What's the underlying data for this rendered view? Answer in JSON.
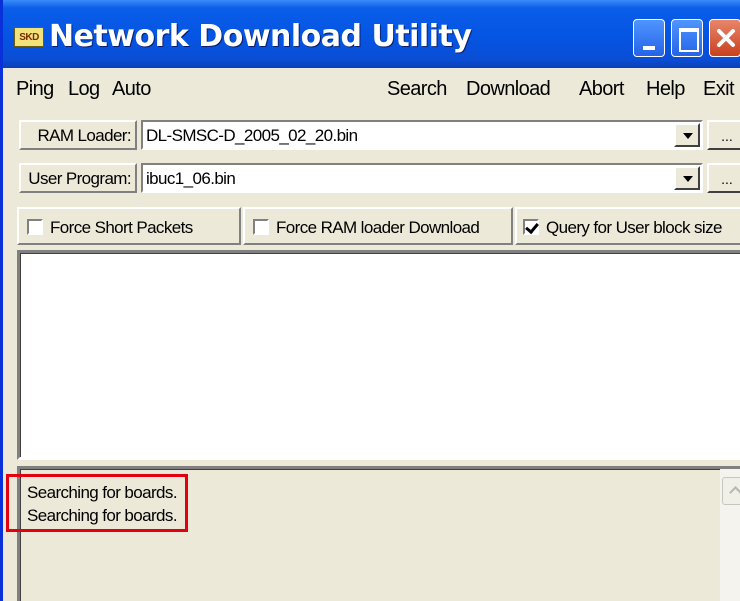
{
  "window": {
    "title": "Network Download Utility",
    "icon_text": "SKD"
  },
  "menu": {
    "ping": "Ping",
    "log": "Log",
    "auto": "Auto",
    "search": "Search",
    "download": "Download",
    "abort": "Abort",
    "help": "Help",
    "exit": "Exit"
  },
  "ram_loader": {
    "label": "RAM Loader:",
    "value": "DL-SMSC-D_2005_02_20.bin",
    "browse": "..."
  },
  "user_program": {
    "label": "User Program:",
    "value": "ibuc1_06.bin",
    "browse": "..."
  },
  "options": {
    "force_short_packets": {
      "label": "Force Short Packets",
      "checked": false
    },
    "force_ram_loader": {
      "label": "Force RAM loader Download",
      "checked": false
    },
    "query_user_block": {
      "label": "Query for User block size",
      "checked": true
    }
  },
  "log": {
    "lines": [
      "Searching for boards.",
      "Searching for boards."
    ]
  },
  "colors": {
    "titlebar": "#0554e3",
    "highlight": "#e3000f",
    "face": "#ece9d8"
  }
}
